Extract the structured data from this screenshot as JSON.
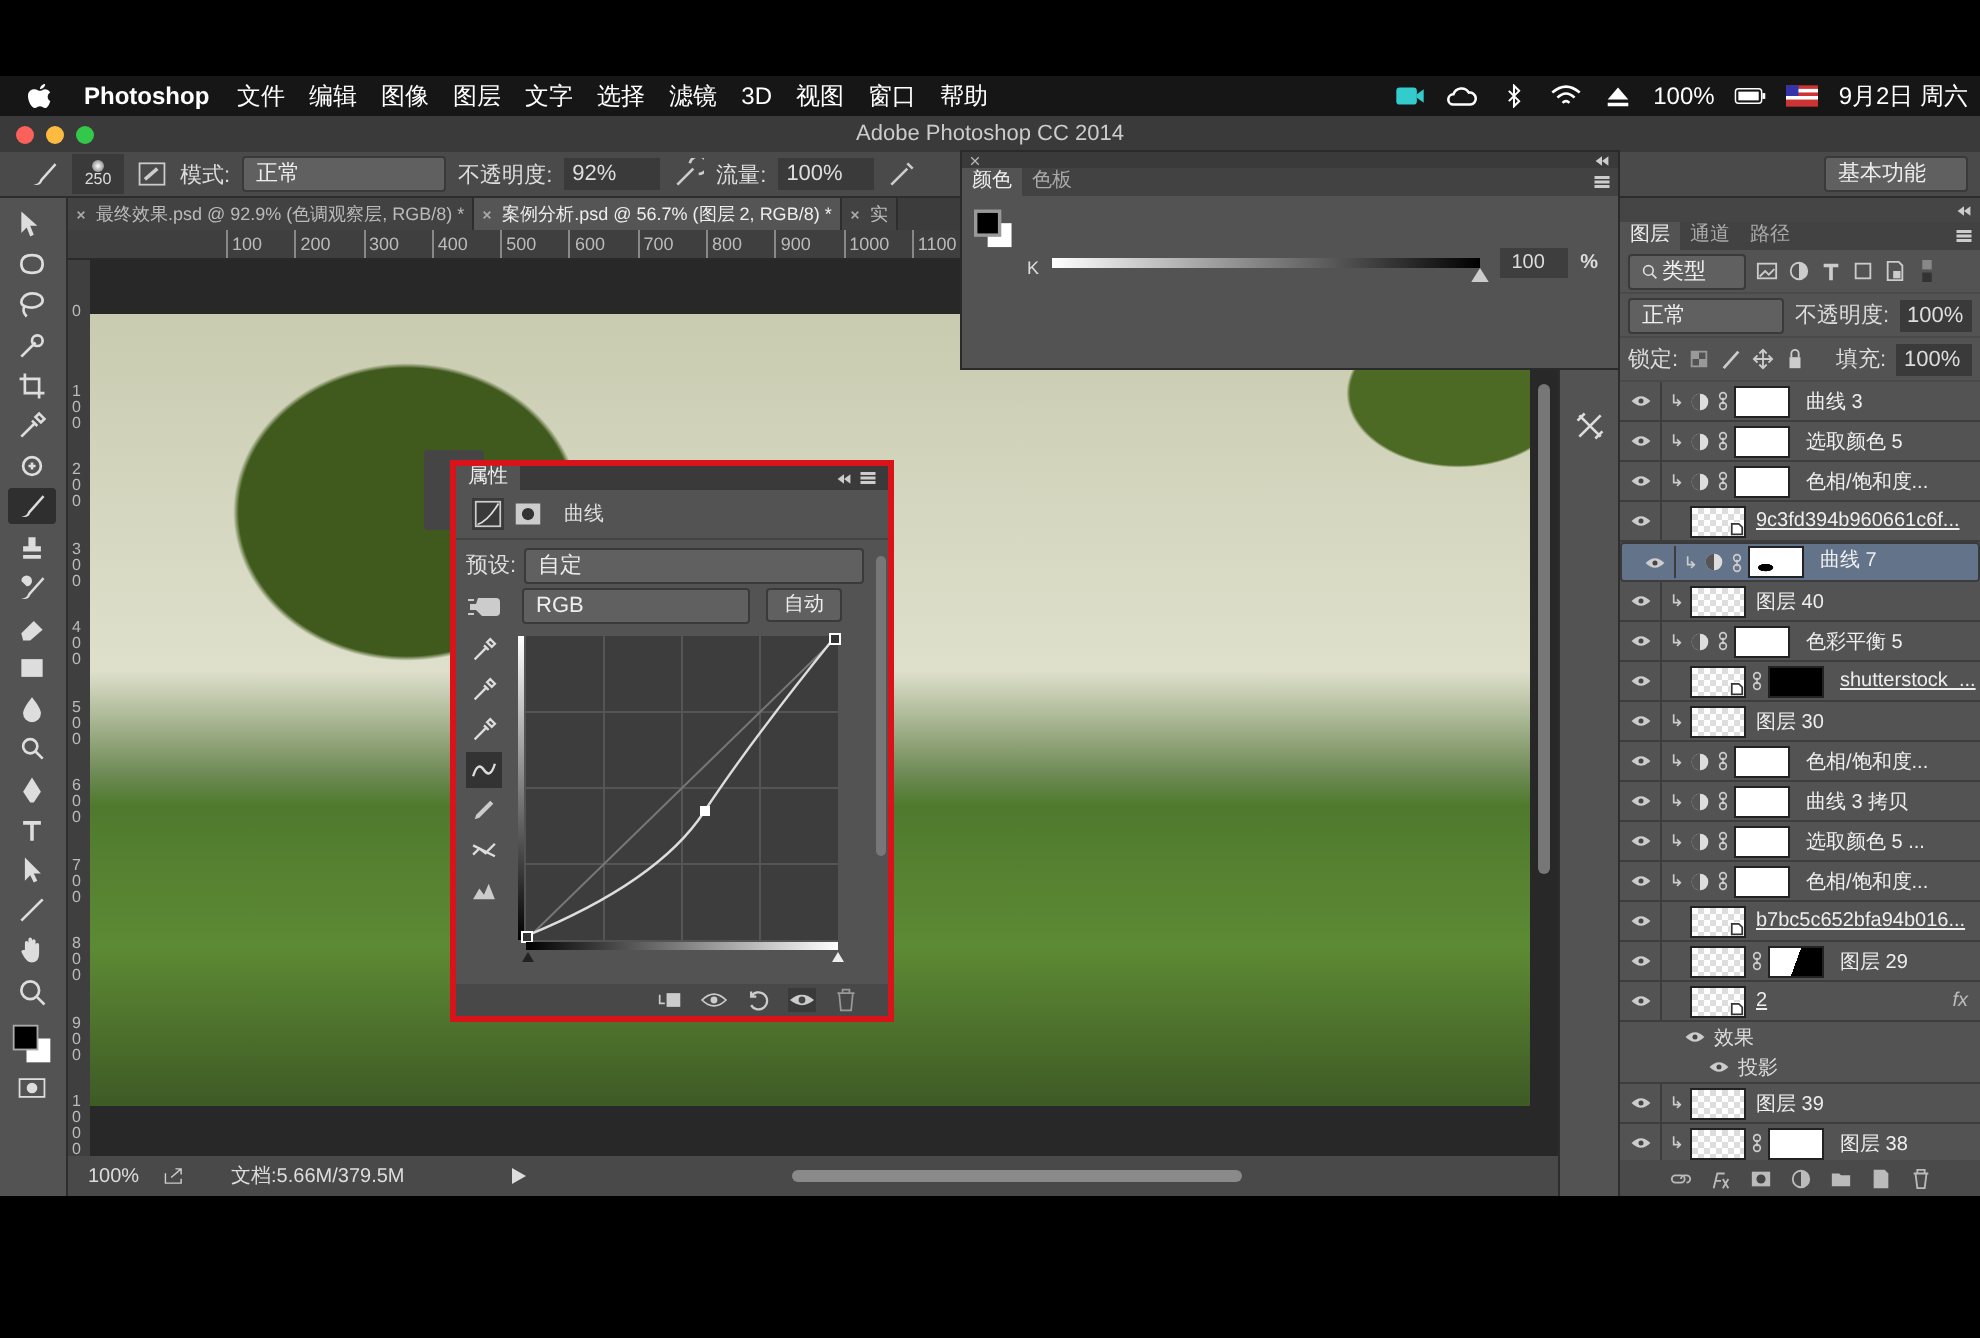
{
  "menubar": {
    "app": "Photoshop",
    "menus": [
      "文件",
      "编辑",
      "图像",
      "图层",
      "文字",
      "选择",
      "滤镜",
      "3D",
      "视图",
      "窗口",
      "帮助"
    ],
    "battery": "100%",
    "clock": "9月2日 周六"
  },
  "window": {
    "title": "Adobe Photoshop CC 2014"
  },
  "options_bar": {
    "brush_size": "250",
    "mode_label": "模式:",
    "mode": "正常",
    "opacity_label": "不透明度:",
    "opacity": "92%",
    "flow_label": "流量:",
    "flow": "100%",
    "workspace": "基本功能"
  },
  "tools": [
    {
      "kind": "move",
      "selected": false
    },
    {
      "kind": "marquee",
      "selected": false
    },
    {
      "kind": "lasso",
      "selected": false
    },
    {
      "kind": "quick-select",
      "selected": false
    },
    {
      "kind": "crop",
      "selected": false
    },
    {
      "kind": "eyedropper",
      "selected": false
    },
    {
      "kind": "healing",
      "selected": false
    },
    {
      "kind": "brush",
      "selected": true
    },
    {
      "kind": "stamp",
      "selected": false
    },
    {
      "kind": "history-brush",
      "selected": false
    },
    {
      "kind": "eraser",
      "selected": false
    },
    {
      "kind": "gradient",
      "selected": false
    },
    {
      "kind": "blur",
      "selected": false
    },
    {
      "kind": "dodge",
      "selected": false
    },
    {
      "kind": "pen",
      "selected": false
    },
    {
      "kind": "type",
      "selected": false
    },
    {
      "kind": "path-select",
      "selected": false
    },
    {
      "kind": "line",
      "selected": false
    },
    {
      "kind": "hand",
      "selected": false
    },
    {
      "kind": "zoom",
      "selected": false
    }
  ],
  "document_tabs": [
    {
      "label": "最终效果.psd @ 92.9% (色调观察层, RGB/8) *",
      "selected": false
    },
    {
      "label": "案例分析.psd @ 56.7% (图层 2, RGB/8) *",
      "selected": true
    },
    {
      "label": "实",
      "selected": false
    }
  ],
  "ruler": {
    "x_labels": [
      "100",
      "200",
      "300",
      "400",
      "500",
      "600",
      "700",
      "800",
      "900",
      "1000",
      "1100"
    ],
    "y_labels": [
      "0",
      "100",
      "200",
      "300",
      "400",
      "500",
      "600",
      "700",
      "800",
      "900",
      "1000"
    ]
  },
  "color_panel": {
    "tabs": [
      {
        "label": "颜色",
        "selected": true
      },
      {
        "label": "色板",
        "selected": false
      }
    ],
    "channel": "K",
    "level": 1.0,
    "value": "100",
    "unit": "%"
  },
  "properties": {
    "title": "属性",
    "type": "曲线",
    "preset_label": "预设:",
    "preset": "自定",
    "channel": "RGB",
    "auto_button": "自动",
    "tools": [
      {
        "kind": "eyedropper",
        "selected": false
      },
      {
        "kind": "eyedropper",
        "selected": false
      },
      {
        "kind": "eyedropper",
        "selected": false
      },
      {
        "kind": "curve",
        "selected": true
      },
      {
        "kind": "pencil",
        "selected": false
      },
      {
        "kind": "smooth",
        "selected": false
      },
      {
        "kind": "clipping",
        "selected": false
      }
    ]
  },
  "layers_panel": {
    "tabs": [
      {
        "label": "图层",
        "selected": true
      },
      {
        "label": "通道",
        "selected": false
      },
      {
        "label": "路径",
        "selected": false
      }
    ],
    "filter": "类型",
    "blend_mode": "正常",
    "opacity_label": "不透明度:",
    "opacity": "100%",
    "lock_label": "锁定:",
    "fill_label": "填充:",
    "fill": "100%",
    "layers": [
      {
        "name": "曲线 3",
        "kind": "adjustment",
        "clipped": true,
        "selected": false,
        "visible": true,
        "mask": {
          "kind": "white"
        }
      },
      {
        "name": "选取颜色 5",
        "kind": "adjustment",
        "clipped": true,
        "selected": false,
        "visible": true,
        "mask": {
          "kind": "white"
        }
      },
      {
        "name": "色相/饱和度...",
        "kind": "adjustment",
        "clipped": true,
        "selected": false,
        "visible": true,
        "mask": {
          "kind": "white"
        }
      },
      {
        "name": "9c3fd394b960661c6f...",
        "kind": "smart",
        "clipped": false,
        "selected": false,
        "visible": true
      },
      {
        "name": "曲线 7",
        "kind": "adjustment",
        "clipped": true,
        "selected": true,
        "visible": true,
        "mask": {
          "kind": "spot"
        }
      },
      {
        "name": "图层 40",
        "kind": "pixel",
        "clipped": true,
        "selected": false,
        "visible": true
      },
      {
        "name": "色彩平衡 5",
        "kind": "adjustment",
        "clipped": true,
        "selected": false,
        "visible": true,
        "mask": {
          "kind": "white"
        }
      },
      {
        "name": "shutterstock_...",
        "kind": "smart",
        "clipped": false,
        "selected": false,
        "visible": true,
        "mask": {
          "kind": "black"
        }
      },
      {
        "name": "图层 30",
        "kind": "pixel",
        "clipped": true,
        "selected": false,
        "visible": true
      },
      {
        "name": "色相/饱和度...",
        "kind": "adjustment",
        "clipped": true,
        "selected": false,
        "visible": true,
        "mask": {
          "kind": "white"
        }
      },
      {
        "name": "曲线 3 拷贝",
        "kind": "adjustment",
        "clipped": true,
        "selected": false,
        "visible": true,
        "mask": {
          "kind": "white"
        }
      },
      {
        "name": "选取颜色 5 ...",
        "kind": "adjustment",
        "clipped": true,
        "selected": false,
        "visible": true,
        "mask": {
          "kind": "white"
        }
      },
      {
        "name": "色相/饱和度...",
        "kind": "adjustment",
        "clipped": true,
        "selected": false,
        "visible": true,
        "mask": {
          "kind": "white"
        }
      },
      {
        "name": "b7bc5c652bfa94b016...",
        "kind": "smart",
        "clipped": false,
        "selected": false,
        "visible": true
      },
      {
        "name": "图层 29",
        "kind": "pixel",
        "clipped": false,
        "selected": false,
        "visible": true,
        "mask": {
          "kind": "half"
        }
      },
      {
        "name": "2",
        "kind": "smart",
        "clipped": false,
        "selected": false,
        "visible": true,
        "fx": "fx",
        "effects": [
          {
            "label": "效果",
            "visible": true,
            "children": [
              {
                "label": "投影",
                "visible": true
              }
            ]
          }
        ]
      },
      {
        "name": "图层 39",
        "kind": "pixel",
        "clipped": true,
        "selected": false,
        "visible": true
      },
      {
        "name": "图层 38",
        "kind": "pixel",
        "clipped": true,
        "selected": false,
        "visible": true,
        "mask": {
          "kind": "white"
        }
      }
    ]
  },
  "status_bar": {
    "zoom": "100%",
    "doc_info": "文档:5.66M/379.5M"
  }
}
